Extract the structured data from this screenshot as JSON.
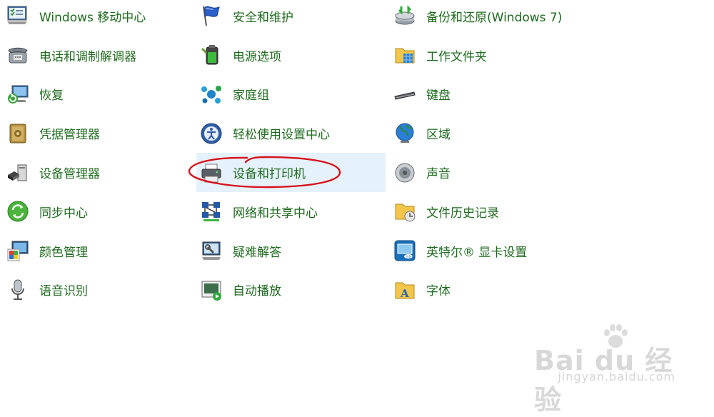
{
  "columns": [
    [
      {
        "label": "Windows 移动中心",
        "icon": "mobility-center-icon"
      },
      {
        "label": "电话和调制解调器",
        "icon": "phone-modem-icon"
      },
      {
        "label": "恢复",
        "icon": "recovery-icon"
      },
      {
        "label": "凭据管理器",
        "icon": "credential-manager-icon"
      },
      {
        "label": "设备管理器",
        "icon": "device-manager-icon"
      },
      {
        "label": "同步中心",
        "icon": "sync-center-icon"
      },
      {
        "label": "颜色管理",
        "icon": "color-management-icon"
      },
      {
        "label": "语音识别",
        "icon": "microphone-icon"
      }
    ],
    [
      {
        "label": "安全和维护",
        "icon": "security-flag-icon"
      },
      {
        "label": "电源选项",
        "icon": "power-options-icon"
      },
      {
        "label": "家庭组",
        "icon": "homegroup-icon"
      },
      {
        "label": "轻松使用设置中心",
        "icon": "ease-of-access-icon"
      },
      {
        "label": "设备和打印机",
        "icon": "printer-icon"
      },
      {
        "label": "网络和共享中心",
        "icon": "network-sharing-icon"
      },
      {
        "label": "疑难解答",
        "icon": "troubleshooting-icon"
      },
      {
        "label": "自动播放",
        "icon": "autoplay-icon"
      }
    ],
    [
      {
        "label": "备份和还原(Windows 7)",
        "icon": "backup-restore-icon"
      },
      {
        "label": "工作文件夹",
        "icon": "work-folders-icon"
      },
      {
        "label": "键盘",
        "icon": "keyboard-icon"
      },
      {
        "label": "区域",
        "icon": "region-globe-icon"
      },
      {
        "label": "声音",
        "icon": "speaker-icon"
      },
      {
        "label": "文件历史记录",
        "icon": "file-history-icon"
      },
      {
        "label": "英特尔® 显卡设置",
        "icon": "intel-graphics-icon"
      },
      {
        "label": "字体",
        "icon": "fonts-folder-icon"
      }
    ]
  ],
  "selected": {
    "column": 1,
    "row": 4
  },
  "watermark": {
    "main": "Bai du 经验",
    "sub": "jingyan.baidu.com"
  },
  "colors": {
    "link": "#1e6a1e",
    "selected_bg": "#e5f1fb",
    "annotation": "#d8101a"
  }
}
